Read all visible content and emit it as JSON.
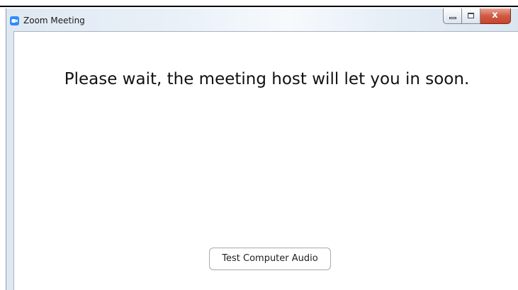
{
  "window": {
    "title": "Zoom Meeting",
    "icon": "zoom-camera-icon",
    "controls": {
      "minimize": "minimize-icon",
      "maximize": "maximize-icon",
      "close_glyph": "x"
    }
  },
  "main": {
    "message": "Please wait, the meeting host will let you in soon.",
    "test_audio_label": "Test Computer Audio"
  },
  "colors": {
    "zoom_blue": "#2d8cff",
    "close_red": "#c7442c",
    "text": "#111111"
  }
}
